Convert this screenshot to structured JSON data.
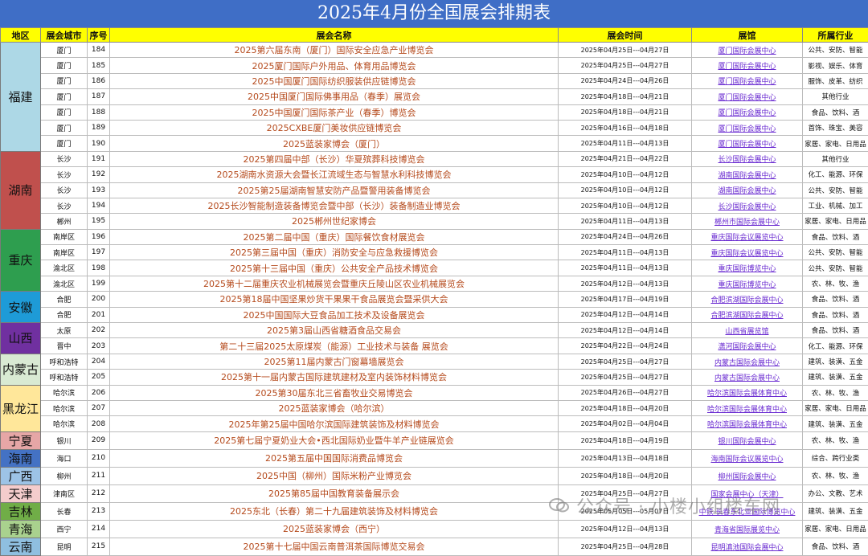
{
  "title": "2025年4月份全国展会排期表",
  "headers": [
    "地区",
    "展会城市",
    "序号",
    "展会名称",
    "展会时间",
    "展馆",
    "所属行业"
  ],
  "watermark": "公众号 · 小楼小组楼车网",
  "colors": {
    "title_bg": "#3f6ec6",
    "header_bg": "#ffff00",
    "name_text": "#b54a1c",
    "venue_text": "#6a2bd1"
  },
  "groups": [
    {
      "region": "福建",
      "color": "#add8e6",
      "rows": [
        {
          "city": "厦门",
          "seq": "184",
          "name": "2025第六届东南（厦门）国际安全应急产业博览会",
          "time": "2025年04月25日---04月27日",
          "venue": "厦门国际会展中心",
          "industry": "公共、安防、智能"
        },
        {
          "city": "厦门",
          "seq": "185",
          "name": "2025厦门国际户外用品、体育用品博览会",
          "time": "2025年04月25日---04月27日",
          "venue": "厦门国际会展中心",
          "industry": "影视、娱乐、体育"
        },
        {
          "city": "厦门",
          "seq": "186",
          "name": "2025中国厦门国际纺织服装供应链博览会",
          "time": "2025年04月24日---04月26日",
          "venue": "厦门国际会展中心",
          "industry": "服饰、皮革、纺织"
        },
        {
          "city": "厦门",
          "seq": "187",
          "name": "2025中国厦门国际佛事用品（春季）展览会",
          "time": "2025年04月18日---04月21日",
          "venue": "厦门国际会展中心",
          "industry": "其他行业"
        },
        {
          "city": "厦门",
          "seq": "188",
          "name": "2025中国厦门国际茶产业（春季）博览会",
          "time": "2025年04月18日---04月21日",
          "venue": "厦门国际会展中心",
          "industry": "食品、饮料、酒"
        },
        {
          "city": "厦门",
          "seq": "189",
          "name": "2025CXBE厦门美妆供应链博览会",
          "time": "2025年04月16日---04月18日",
          "venue": "厦门国际会展中心",
          "industry": "首饰、珠宝、美容"
        },
        {
          "city": "厦门",
          "seq": "190",
          "name": "2025蓝装家博会（厦门）",
          "time": "2025年04月11日---04月13日",
          "venue": "厦门国际会展中心",
          "industry": "家居、家电、日用品"
        }
      ]
    },
    {
      "region": "湖南",
      "color": "#c0504d",
      "rows": [
        {
          "city": "长沙",
          "seq": "191",
          "name": "2025第四届中部（长沙）华夏殡葬科技博览会",
          "time": "2025年04月21日---04月22日",
          "venue": "长沙国际会展中心",
          "industry": "其他行业"
        },
        {
          "city": "长沙",
          "seq": "192",
          "name": "2025湖南水资源大会暨长江流域生态与智慧水利科技博览会",
          "time": "2025年04月10日---04月12日",
          "venue": "湖南国际会展中心",
          "industry": "化工、能源、环保"
        },
        {
          "city": "长沙",
          "seq": "193",
          "name": "2025第25届湖南智慧安防产品暨警用装备博览会",
          "time": "2025年04月10日---04月12日",
          "venue": "湖南国际会展中心",
          "industry": "公共、安防、智能"
        },
        {
          "city": "长沙",
          "seq": "194",
          "name": "2025长沙智能制造装备博览会暨中部（长沙）装备制造业博览会",
          "time": "2025年04月10日---04月12日",
          "venue": "长沙国际会展中心",
          "industry": "工业、机械、加工"
        },
        {
          "city": "郴州",
          "seq": "195",
          "name": "2025郴州世纪家博会",
          "time": "2025年04月11日---04月13日",
          "venue": "郴州市国际会展中心",
          "industry": "家居、家电、日用品"
        }
      ]
    },
    {
      "region": "重庆",
      "color": "#2e9e4f",
      "rows": [
        {
          "city": "南岸区",
          "seq": "196",
          "name": "2025第二届中国（重庆）国际餐饮食材展览会",
          "time": "2025年04月24日---04月26日",
          "venue": "重庆国际会议展览中心",
          "industry": "食品、饮料、酒"
        },
        {
          "city": "南岸区",
          "seq": "197",
          "name": "2025第三届中国（重庆）消防安全与应急救援博览会",
          "time": "2025年04月11日---04月13日",
          "venue": "重庆国际会议展览中心",
          "industry": "公共、安防、智能"
        },
        {
          "city": "渝北区",
          "seq": "198",
          "name": "2025第十三届中国（重庆）公共安全产品技术博览会",
          "time": "2025年04月11日---04月13日",
          "venue": "重庆国际博览中心",
          "industry": "公共、安防、智能"
        },
        {
          "city": "渝北区",
          "seq": "199",
          "name": "2025第十二届重庆农业机械展览会暨重庆丘陵山区农业机械展览会",
          "time": "2025年04月12日---04月13日",
          "venue": "重庆国际博览中心",
          "industry": "农、林、牧、渔"
        }
      ]
    },
    {
      "region": "安徽",
      "color": "#1e9bd7",
      "rows": [
        {
          "city": "合肥",
          "seq": "200",
          "name": "2025第18届中国坚果炒货干果果干食品展览会暨采供大会",
          "time": "2025年04月17日---04月19日",
          "venue": "合肥滨湖国际会展中心",
          "industry": "食品、饮料、酒"
        },
        {
          "city": "合肥",
          "seq": "201",
          "name": "2025中国国际大豆食品加工技术及设备展览会",
          "time": "2025年04月12日---04月14日",
          "venue": "合肥滨湖国际会展中心",
          "industry": "食品、饮料、酒"
        }
      ]
    },
    {
      "region": "山西",
      "color": "#7030a0",
      "rows": [
        {
          "city": "太原",
          "seq": "202",
          "name": "2025第3届山西省糖酒食品交易会",
          "time": "2025年04月12日---04月14日",
          "venue": "山西省展览馆",
          "industry": "食品、饮料、酒"
        },
        {
          "city": "晋中",
          "seq": "203",
          "name": "第二十三届2025太原煤炭（能源）工业技术与装备 展览会",
          "time": "2025年04月22日---04月24日",
          "venue": "潇河国际会展中心",
          "industry": "化工、能源、环保"
        }
      ]
    },
    {
      "region": "内蒙古",
      "color": "#d9ead3",
      "rows": [
        {
          "city": "呼和浩特",
          "seq": "204",
          "name": "2025第11届内蒙古门窗幕墙展览会",
          "time": "2025年04月25日---04月27日",
          "venue": "内蒙古国际会展中心",
          "industry": "建筑、装潢、五金"
        },
        {
          "city": "呼和浩特",
          "seq": "205",
          "name": "2025第十一届内蒙古国际建筑建材及室内装饰材料博览会",
          "time": "2025年04月25日---04月27日",
          "venue": "内蒙古国际会展中心",
          "industry": "建筑、装潢、五金"
        }
      ]
    },
    {
      "region": "黑龙江",
      "color": "#ffe79a",
      "rows": [
        {
          "city": "哈尔滨",
          "seq": "206",
          "name": "2025第30届东北三省畜牧业交易博览会",
          "time": "2025年04月26日---04月27日",
          "venue": "哈尔滨国际会展体育中心",
          "industry": "农、林、牧、渔"
        },
        {
          "city": "哈尔滨",
          "seq": "207",
          "name": "2025蓝装家博会（哈尔滨）",
          "time": "2025年04月18日---04月20日",
          "venue": "哈尔滨国际会展体育中心",
          "industry": "家居、家电、日用品"
        },
        {
          "city": "哈尔滨",
          "seq": "208",
          "name": "2025年第25届中国哈尔滨国际建筑装饰及材料博览会",
          "time": "2025年04月02日---04月04日",
          "venue": "哈尔滨国际会展体育中心",
          "industry": "建筑、装潢、五金"
        }
      ]
    },
    {
      "region": "宁夏",
      "color": "#e6a6a6",
      "rows": [
        {
          "city": "银川",
          "seq": "209",
          "name": "2025第七届宁夏奶业大会•西北国际奶业暨牛羊产业链展览会",
          "time": "2025年04月18日---04月19日",
          "venue": "银川国际会展中心",
          "industry": "农、林、牧、渔"
        }
      ]
    },
    {
      "region": "海南",
      "color": "#4472c4",
      "rows": [
        {
          "city": "海口",
          "seq": "210",
          "name": "2025第五届中国国际消费品博览会",
          "time": "2025年04月13日---04月18日",
          "venue": "海南国际会议展览中心",
          "industry": "综合、跨行业类"
        }
      ]
    },
    {
      "region": "广西",
      "color": "#9dc3e6",
      "rows": [
        {
          "city": "柳州",
          "seq": "211",
          "name": "2025中国（柳州）国际米粉产业博览会",
          "time": "2025年04月18日---04月20日",
          "venue": "柳州国际会展中心",
          "industry": "农、林、牧、渔"
        }
      ]
    },
    {
      "region": "天津",
      "color": "#f4cccc",
      "rows": [
        {
          "city": "津南区",
          "seq": "212",
          "name": "2025第85届中国教育装备展示会",
          "time": "2025年04月25日---04月27日",
          "venue": "国家会展中心（天津）",
          "industry": "办公、文教、艺术"
        }
      ]
    },
    {
      "region": "吉林",
      "color": "#70ad47",
      "rows": [
        {
          "city": "长春",
          "seq": "213",
          "name": "2025东北（长春）第二十九届建筑装饰及材料博览会",
          "time": "2025年05月05日---05月07日",
          "venue": "中铁·长春东北亚国际博览中心",
          "industry": "建筑、装潢、五金"
        }
      ]
    },
    {
      "region": "青海",
      "color": "#a9d18e",
      "rows": [
        {
          "city": "西宁",
          "seq": "214",
          "name": "2025蓝装家博会（西宁）",
          "time": "2025年04月12日---04月13日",
          "venue": "青海省国际展览中心",
          "industry": "家居、家电、日用品"
        }
      ]
    },
    {
      "region": "云南",
      "color": "#8fbfe0",
      "rows": [
        {
          "city": "昆明",
          "seq": "215",
          "name": "2025第十七届中国云南普洱茶国际博览交易会",
          "time": "2025年04月25日---04月28日",
          "venue": "昆明滇池国际会展中心",
          "industry": "食品、饮料、酒"
        }
      ]
    }
  ]
}
